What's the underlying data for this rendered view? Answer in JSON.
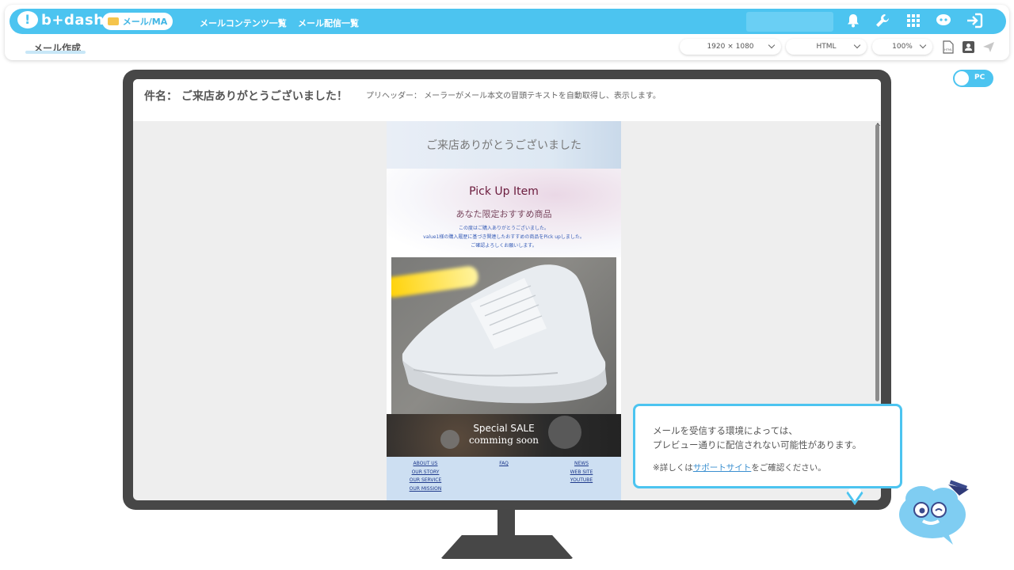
{
  "app": {
    "logo_text": "b+dash"
  },
  "header": {
    "active_section": "メール/MA",
    "nav": [
      "メールコンテンツ一覧",
      "メール配信一覧"
    ],
    "icons": [
      "bell-icon",
      "wrench-icon",
      "grid-icon",
      "ai-assistant-icon",
      "logout-icon"
    ]
  },
  "subbar": {
    "tab_label": "メール作成",
    "resolution_select": "1920 × 1080",
    "format_select": "HTML",
    "zoom_select": "100%",
    "icons": [
      "html-file-icon",
      "contact-card-icon",
      "send-icon"
    ]
  },
  "view_toggle": {
    "label": "PC"
  },
  "preview": {
    "subject_label": "件名：",
    "subject": "ご来店ありがとうございました！",
    "preheader_label": "プリヘッダー：",
    "preheader": "メーラーがメール本文の冒頭テキストを自動取得し、表示します。"
  },
  "email": {
    "header_title": "ご来店ありがとうございました",
    "pick_title": "Pick Up Item",
    "pick_subtitle": "あなた限定おすすめ商品",
    "pick_text_1": "この度はご購入ありがとうございました。",
    "pick_text_2": "value1様の購入履歴に基づき関連したおすすめの商品をPick upしました。",
    "pick_text_3": "ご確認よろしくお願いします。",
    "sale_title": "Special SALE",
    "sale_subtitle": "comming soon",
    "footer_col1": [
      "ABOUT US",
      "OUR STORY",
      "OUR SERVICE",
      "OUR MISSION"
    ],
    "footer_col2": [
      "FAQ"
    ],
    "footer_col3": [
      "NEWS",
      "WEB SITE",
      "YOUTUBE"
    ]
  },
  "tooltip": {
    "line1": "メールを受信する環境によっては、",
    "line2": "プレビュー通りに配信されない可能性があります。",
    "note_prefix": "※詳しくは",
    "note_link": "サポートサイト",
    "note_suffix": "をご確認ください。"
  },
  "colors": {
    "accent": "#4cc4f0",
    "monitor": "#474747",
    "link": "#3a8fd0"
  }
}
